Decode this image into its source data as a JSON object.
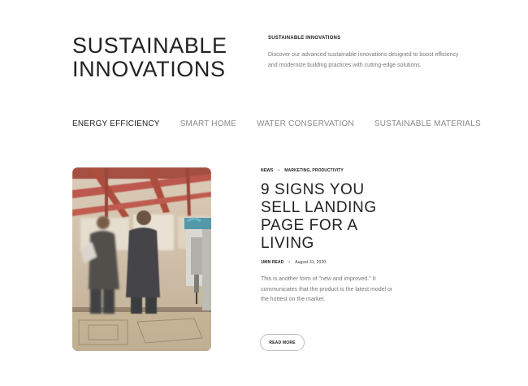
{
  "hero": {
    "title_lines": [
      "SUSTAINABLE",
      "INNOVATIONS"
    ]
  },
  "intro": {
    "heading": "SUSTAINABLE INNOVATIONS",
    "text": "Discover our advanced sustainable innovations designed to boost efficiency and modernize building practices with cutting-edge solutions."
  },
  "tabs": [
    {
      "label": "ENERGY EFFICIENCY",
      "active": true
    },
    {
      "label": "SMART HOME",
      "active": false
    },
    {
      "label": "WATER CONSERVATION",
      "active": false
    },
    {
      "label": "SUSTAINABLE MATERIALS",
      "active": false
    }
  ],
  "post": {
    "category": "NEWS",
    "tags": "MARKETING, PRODUCTIVITY",
    "title_lines": [
      "9 SIGNS YOU",
      "SELL LANDING",
      "PAGE FOR A",
      "LIVING"
    ],
    "read_time": "1MIN READ",
    "date": "August 31, 2020",
    "excerpt": "This is another form of \"new and improved.\" It communicates that the product is the latest model or the hottest on the market.",
    "button_label": "READ MORE",
    "image": "workshop-photo"
  },
  "colors": {
    "text": "#222222",
    "muted": "#777777",
    "tab_inactive": "#8a8a8a",
    "beam_red": "#b5453a"
  }
}
